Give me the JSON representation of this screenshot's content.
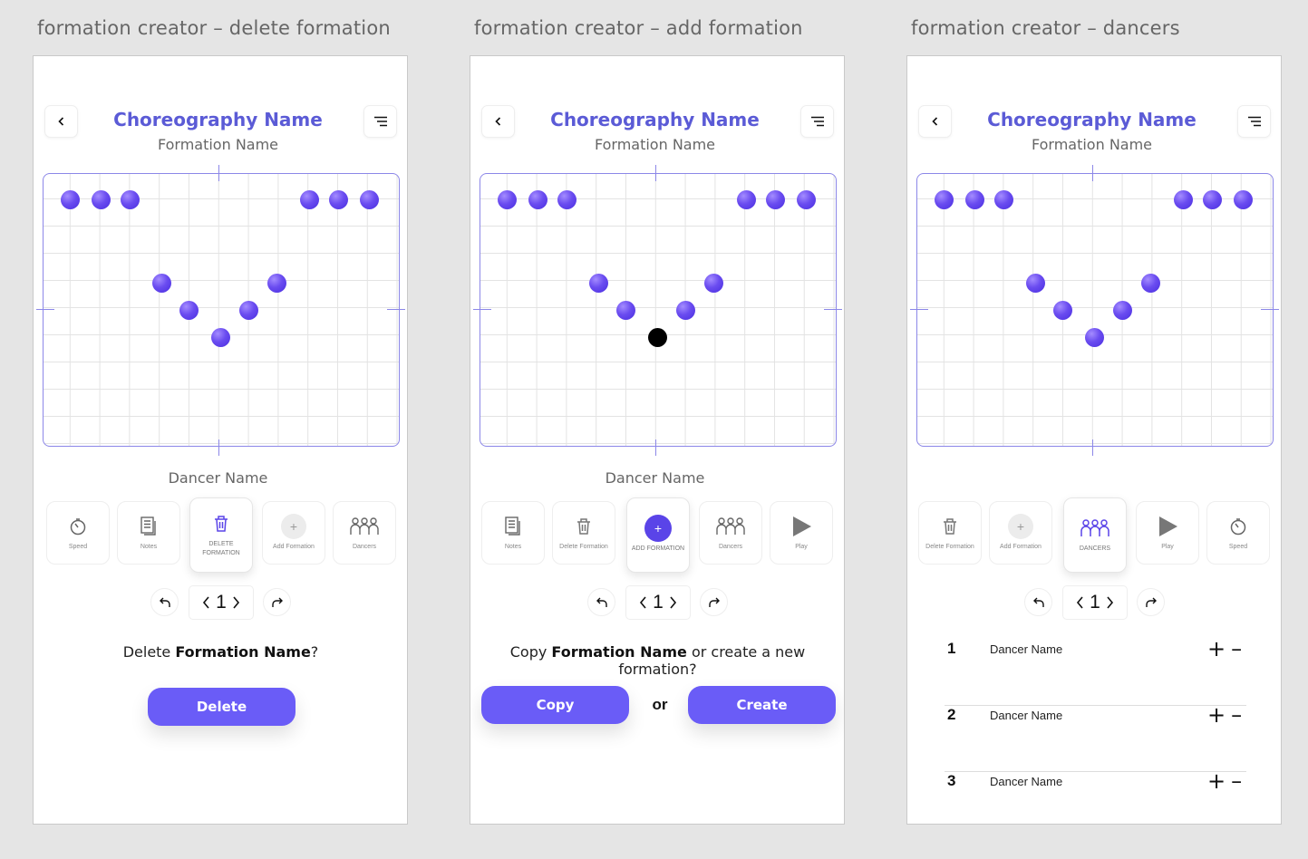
{
  "frames": [
    {
      "title": "formation creator – delete formation",
      "choreography_name": "Choreography Name",
      "formation_name": "Formation Name",
      "dancer_name": "Dancer Name",
      "tools": [
        {
          "label": "Speed",
          "icon": "speed-icon",
          "active": false
        },
        {
          "label": "Notes",
          "icon": "notes-icon",
          "active": false
        },
        {
          "label": "DELETE FORMATION",
          "icon": "trash-icon",
          "active": true
        },
        {
          "label": "Add Formation",
          "icon": "plus-icon",
          "active": false
        },
        {
          "label": "Dancers",
          "icon": "dancers-icon",
          "active": false
        }
      ],
      "page": "1",
      "prompt": {
        "pre": "Delete ",
        "bold": "Formation Name",
        "post": "?"
      },
      "buttons": [
        "Delete"
      ]
    },
    {
      "title": "formation creator – add formation",
      "choreography_name": "Choreography Name",
      "formation_name": "Formation Name",
      "dancer_name": "Dancer Name",
      "tools": [
        {
          "label": "Notes",
          "icon": "notes-icon",
          "active": false
        },
        {
          "label": "Delete Formation",
          "icon": "trash-icon",
          "active": false
        },
        {
          "label": "ADD FORMATION",
          "icon": "plus-icon",
          "active": true
        },
        {
          "label": "Dancers",
          "icon": "dancers-icon",
          "active": false
        },
        {
          "label": "Play",
          "icon": "play-icon",
          "active": false
        }
      ],
      "page": "1",
      "prompt": {
        "pre": "Copy ",
        "bold": "Formation Name",
        "post": " or create a new formation?"
      },
      "buttons": [
        "Copy",
        "Create"
      ],
      "or_text": "or"
    },
    {
      "title": "formation creator – dancers",
      "choreography_name": "Choreography Name",
      "formation_name": "Formation Name",
      "tools": [
        {
          "label": "Delete Formation",
          "icon": "trash-icon",
          "active": false
        },
        {
          "label": "Add Formation",
          "icon": "plus-icon",
          "active": false
        },
        {
          "label": "DANCERS",
          "icon": "dancers-icon",
          "active": true
        },
        {
          "label": "Play",
          "icon": "play-icon",
          "active": false
        },
        {
          "label": "Speed",
          "icon": "speed-icon",
          "active": false
        }
      ],
      "page": "1",
      "dancers": [
        {
          "num": "1",
          "name": "Dancer Name"
        },
        {
          "num": "2",
          "name": "Dancer Name"
        },
        {
          "num": "3",
          "name": "Dancer Name"
        }
      ]
    }
  ],
  "colors": {
    "accent": "#5b5bd6",
    "button": "#6a5cf7",
    "dot": "#5a3ee8",
    "grid_border": "#8c87e8"
  }
}
